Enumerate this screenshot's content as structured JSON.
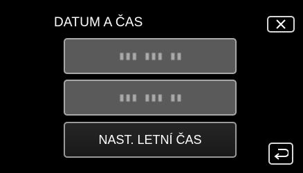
{
  "header": {
    "title": "DATUM A ČAS"
  },
  "menu": {
    "items": [
      {
        "label": "▮▮▮ ▮▮▮ ▮▮",
        "state": "disabled"
      },
      {
        "label": "▮▮▮ ▮▮▮ ▮▮",
        "state": "disabled"
      },
      {
        "label": "NAST. LETNÍ ČAS",
        "state": "enabled"
      }
    ]
  },
  "icons": {
    "close": "close-icon",
    "back": "return-arrow-icon"
  },
  "colors": {
    "background": "#000000",
    "button_border": "#9a9a9a",
    "disabled_fill": "#5a5a5a",
    "text": "#ffffff"
  }
}
